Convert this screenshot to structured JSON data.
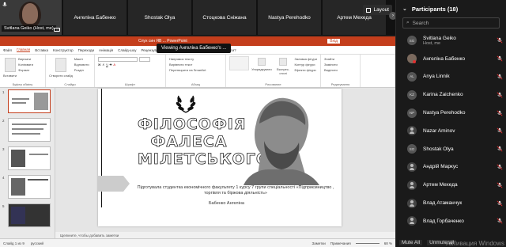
{
  "video_strip": {
    "self_name": "Svitlana Geiko (Host, me)",
    "participants": [
      "Ангеліна Бабенко",
      "Shostak Olya",
      "Стоцкова Сніжана",
      "Nastya Perehodko",
      "Артем Мехеда"
    ],
    "layout_label": "Layout"
  },
  "viewing_banner": "Viewing Ангеліна Бабенко's ...",
  "ppt": {
    "title_text": "Слух син ЯВ ... PowerPoint",
    "signin_label": "Вхід",
    "tabs": [
      "Файл",
      "Главная",
      "Вставка",
      "Конструктор",
      "Переходи",
      "Анімація",
      "Слайд-шоу",
      "Рецензування",
      "Вид",
      "Довідка",
      "Що ви хочете зробити?"
    ],
    "ribbon": {
      "clipboard": [
        "Вирізати",
        "Копіювати",
        "Формат"
      ],
      "slides": [
        "Макет",
        "Відновити",
        "Розділ"
      ],
      "paste_label": "Вставити",
      "create_label": "Створити слайд",
      "group_clipboard": "Буфер обміну",
      "group_slides": "Слайди",
      "group_font": "Шрифт",
      "group_paragraph": "Абзац",
      "group_drawing": "Рисование",
      "group_editing": "Редагування",
      "arrange": "Упорядкувати",
      "styles": "Експрес-стилі",
      "shape_fill": "Заливка фігури",
      "shape_outline": "Контур фігури",
      "shape_effects": "Ефекти фігури",
      "find": "Знайти",
      "replace": "Замінити",
      "select": "Виділити",
      "text_direction": "Напрямок тексту",
      "align_text": "Вирівняти текст",
      "smartart": "Перетворити на SmartArt"
    },
    "slide": {
      "title_lines": [
        "ФІЛОСОФІЯ",
        "ФАЛЕСА",
        "МІЛЕТСЬКОГО"
      ],
      "caption": "Підготувала студентка економічного факультету 1 курсу 7 групи спеціальності «Підприємництво , торгівля та біржова діяльність»",
      "author": "Бабенко Ангеліна"
    },
    "notes_placeholder": "Щелкните, чтобы добавить заметки",
    "status_left": "Слайд 1 из 9",
    "status_lang": "русский",
    "status_notes": "Заметки",
    "status_comments": "Примечания",
    "zoom": "68 %"
  },
  "panel": {
    "title": "Participants (18)",
    "search_placeholder": "Search",
    "participants": [
      {
        "name": "Svitlana Geiko",
        "sub": "Host, me",
        "initials": "SG",
        "avatar": "initials"
      },
      {
        "name": "Ангеліна Бабенко",
        "sub": "",
        "initials": "",
        "avatar": "photo"
      },
      {
        "name": "Anya Linnik",
        "sub": "",
        "initials": "AL",
        "avatar": "initials"
      },
      {
        "name": "Karina Zaichenko",
        "sub": "",
        "initials": "KZ",
        "avatar": "initials"
      },
      {
        "name": "Nastya Perehodko",
        "sub": "",
        "initials": "NP",
        "avatar": "initials"
      },
      {
        "name": "Nazar Aminov",
        "sub": "",
        "initials": "",
        "avatar": "icon"
      },
      {
        "name": "Shostak Olya",
        "sub": "",
        "initials": "SO",
        "avatar": "initials"
      },
      {
        "name": "Андрій Маркус",
        "sub": "",
        "initials": "",
        "avatar": "icon"
      },
      {
        "name": "Артем Мехеда",
        "sub": "",
        "initials": "",
        "avatar": "icon"
      },
      {
        "name": "Влад Атаманчук",
        "sub": "",
        "initials": "",
        "avatar": "icon"
      },
      {
        "name": "Влад Горбаченко",
        "sub": "",
        "initials": "",
        "avatar": "icon"
      }
    ],
    "mute_all": "Mute All",
    "unmute_all": "Unmute all",
    "activation_watermark": "Активация Windows"
  },
  "colors": {
    "ppt_red": "#c43e1c",
    "panel_bg": "#1a1a1a",
    "mute_red": "#e03030"
  }
}
